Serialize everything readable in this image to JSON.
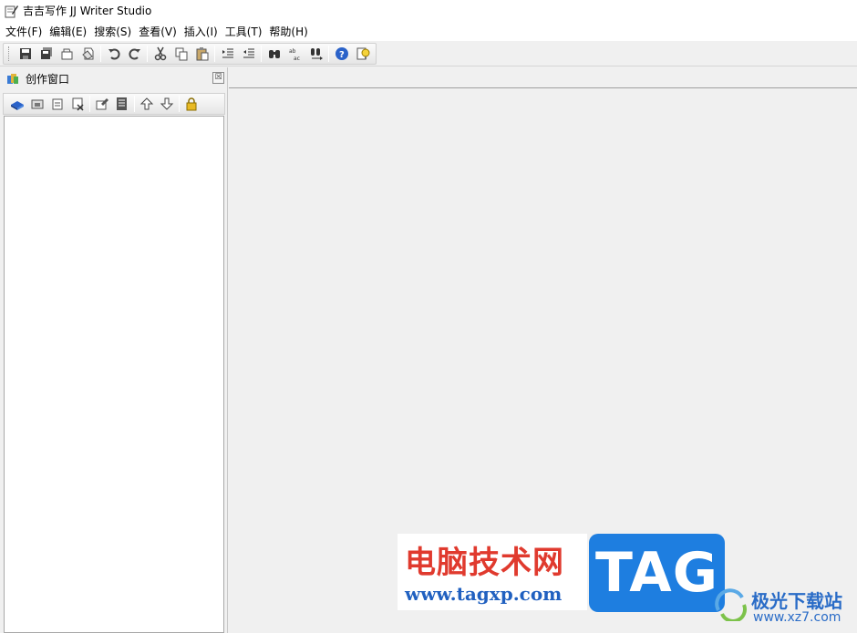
{
  "window": {
    "title": "吉吉写作 JJ Writer Studio"
  },
  "menu": [
    {
      "id": "file",
      "label": "文件(F)"
    },
    {
      "id": "edit",
      "label": "编辑(E)"
    },
    {
      "id": "search",
      "label": "搜索(S)"
    },
    {
      "id": "view",
      "label": "查看(V)"
    },
    {
      "id": "insert",
      "label": "插入(I)"
    },
    {
      "id": "tools",
      "label": "工具(T)"
    },
    {
      "id": "help",
      "label": "帮助(H)"
    }
  ],
  "toolbar": {
    "icons": [
      "save-icon",
      "save-all-icon",
      "open-icon",
      "print-icon",
      "undo-icon",
      "redo-icon",
      "cut-icon",
      "copy-icon",
      "paste-icon",
      "indent-icon",
      "outdent-icon",
      "find-icon",
      "replace-icon",
      "find-next-icon",
      "help-icon",
      "tip-icon"
    ]
  },
  "panel": {
    "title": "创作窗口",
    "close_glyph": "☒",
    "icons": [
      "new-book-icon",
      "new-folder-icon",
      "new-document-icon",
      "delete-icon",
      "properties-icon",
      "notes-icon",
      "move-up-icon",
      "move-down-icon",
      "lock-icon"
    ]
  },
  "watermark": {
    "cn_text": "电脑技术网",
    "url": "www.tagxp.com",
    "tag": "TAG",
    "site_cn": "极光下载站",
    "site_url": "www.xz7.com"
  },
  "colors": {
    "accent_blue": "#1e7ee0",
    "watermark_red": "#e03a2e",
    "panel_bg": "#f0f0f0"
  }
}
